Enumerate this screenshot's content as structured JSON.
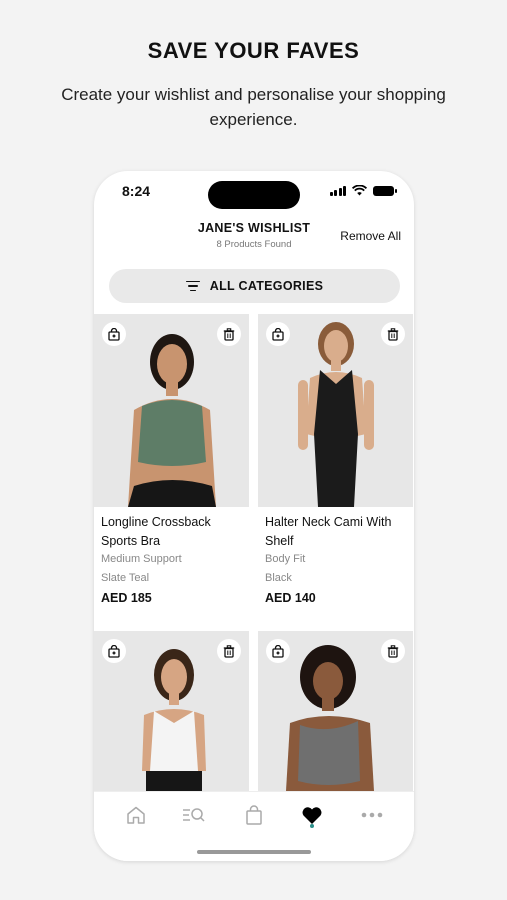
{
  "promo": {
    "title": "SAVE YOUR FAVES",
    "subtitle": "Create your wishlist and personalise your shopping experience."
  },
  "status_bar": {
    "time": "8:24"
  },
  "header": {
    "title": "JANE'S WISHLIST",
    "count": "8 Products Found",
    "remove_all": "Remove All"
  },
  "category_filter": {
    "label": "ALL CATEGORIES",
    "icon": "filter-icon"
  },
  "products": [
    {
      "name": "Longline Crossback Sports Bra",
      "fit": "Medium Support",
      "color": "Slate Teal",
      "price": "AED 185",
      "swatch": "#5e7d67"
    },
    {
      "name": "Halter Neck Cami With Shelf",
      "fit": "Body Fit",
      "color": "Black",
      "price": "AED 140",
      "swatch": "#1b1b1b"
    },
    {
      "name": "",
      "fit": "",
      "color": "",
      "price": "",
      "swatch": "#f4f4f4"
    },
    {
      "name": "",
      "fit": "",
      "color": "",
      "price": "",
      "swatch": "#6f6f6f"
    }
  ],
  "tab_bar": {
    "items": [
      "home-icon",
      "search-icon",
      "bag-icon",
      "heart-icon",
      "more-icon"
    ],
    "active": "heart-icon",
    "accent": "#2a8f8a"
  }
}
